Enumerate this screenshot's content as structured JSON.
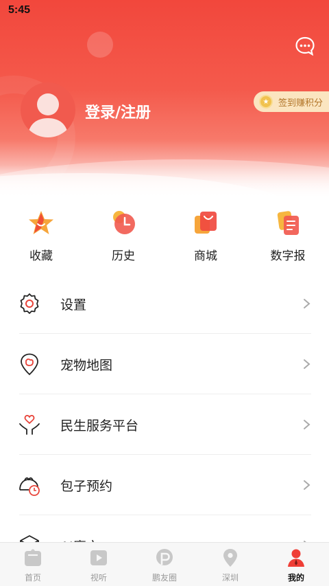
{
  "status_bar": {
    "time": "5:45"
  },
  "header": {
    "login_label": "登录/注册",
    "checkin_label": "签到赚积分"
  },
  "quick_actions": [
    {
      "label": "收藏",
      "icon": "star-icon"
    },
    {
      "label": "历史",
      "icon": "clock-icon"
    },
    {
      "label": "商城",
      "icon": "shopping-bag-icon"
    },
    {
      "label": "数字报",
      "icon": "newspaper-icon"
    }
  ],
  "menu": [
    {
      "label": "设置",
      "icon": "gear-icon"
    },
    {
      "label": "宠物地图",
      "icon": "pet-map-icon"
    },
    {
      "label": "民生服务平台",
      "icon": "heart-hands-icon"
    },
    {
      "label": "包子预约",
      "icon": "bun-clock-icon"
    },
    {
      "label": "AI魔方",
      "icon": "cube-icon"
    }
  ],
  "tabs": [
    {
      "label": "首页",
      "icon": "home-icon",
      "active": false
    },
    {
      "label": "视听",
      "icon": "play-icon",
      "active": false
    },
    {
      "label": "鹏友圈",
      "icon": "circle-p-icon",
      "active": false
    },
    {
      "label": "深圳",
      "icon": "location-pin-icon",
      "active": false
    },
    {
      "label": "我的",
      "icon": "user-icon",
      "active": true
    }
  ],
  "colors": {
    "accent": "#f2473c",
    "checkin_bg": "#fbe5c0",
    "checkin_text": "#b27528"
  }
}
